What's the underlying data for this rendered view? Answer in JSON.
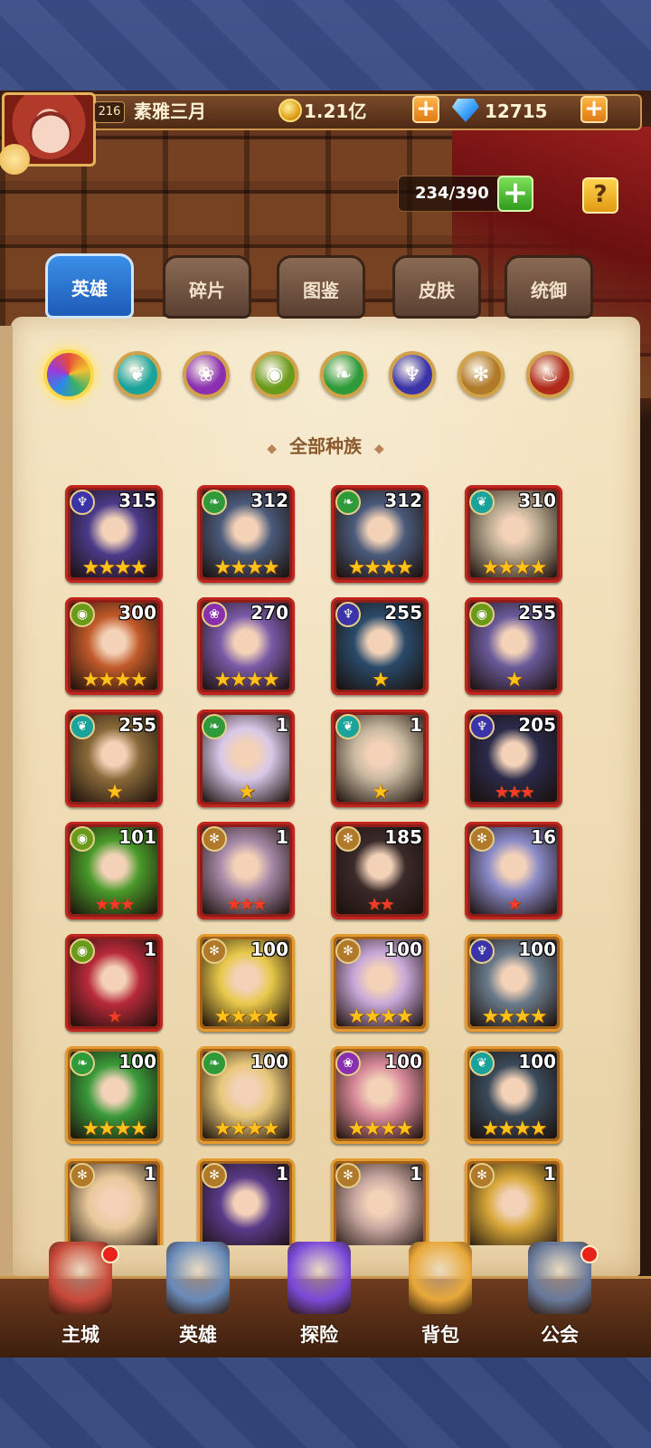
{
  "player": {
    "level": "216",
    "name": "素雅三月",
    "gold": "1.21亿",
    "gems": "12715"
  },
  "capacity": "234/390",
  "help_label": "?",
  "tabs": [
    {
      "label": "英雄",
      "active": true
    },
    {
      "label": "碎片",
      "active": false
    },
    {
      "label": "图鉴",
      "active": false
    },
    {
      "label": "皮肤",
      "active": false
    },
    {
      "label": "统御",
      "active": false
    }
  ],
  "race_filters": [
    {
      "icon": "all-races-icon",
      "color": "#e84a3a",
      "active": true
    },
    {
      "icon": "race-cyan-icon",
      "color": "#1aa39a"
    },
    {
      "icon": "race-purple-icon",
      "color": "#8a2fb0"
    },
    {
      "icon": "race-green-eye-icon",
      "color": "#6a9a1a"
    },
    {
      "icon": "race-leaf-icon",
      "color": "#2f9a3a"
    },
    {
      "icon": "race-demon-icon",
      "color": "#3a34a8"
    },
    {
      "icon": "race-light-icon",
      "color": "#b07a2a"
    },
    {
      "icon": "race-red-icon",
      "color": "#b02a1a"
    }
  ],
  "section_title": "全部种族",
  "heroes": [
    {
      "level": "315",
      "race": "demon",
      "stars": "★★★★",
      "star_type": "gold",
      "frame": "red",
      "color": "#4a3a8a"
    },
    {
      "level": "312",
      "race": "leaf",
      "stars": "★★★★",
      "star_type": "gold",
      "frame": "red",
      "color": "#4a5a7a"
    },
    {
      "level": "312",
      "race": "leaf",
      "stars": "★★★★",
      "star_type": "gold",
      "frame": "red",
      "color": "#4a5a7a"
    },
    {
      "level": "310",
      "race": "cyan",
      "stars": "★★★★",
      "star_type": "gold",
      "frame": "red",
      "color": "#b8a890"
    },
    {
      "level": "300",
      "race": "green-eye",
      "stars": "★★★★",
      "star_type": "gold",
      "frame": "red",
      "color": "#c25a2a"
    },
    {
      "level": "270",
      "race": "purple",
      "stars": "★★★★",
      "star_type": "gold",
      "frame": "red",
      "color": "#7a5aa8"
    },
    {
      "level": "255",
      "race": "demon",
      "stars": "★",
      "star_type": "gold",
      "frame": "red",
      "color": "#2a4a6a"
    },
    {
      "level": "255",
      "race": "green-eye",
      "stars": "★",
      "star_type": "gold",
      "frame": "red",
      "color": "#6a5a9a"
    },
    {
      "level": "255",
      "race": "cyan",
      "stars": "★",
      "star_type": "gold",
      "frame": "red",
      "color": "#8a6a3a"
    },
    {
      "level": "1",
      "race": "leaf",
      "stars": "★",
      "star_type": "gold",
      "frame": "red",
      "color": "#d8c8e8"
    },
    {
      "level": "1",
      "race": "cyan",
      "stars": "★",
      "star_type": "gold",
      "frame": "red",
      "color": "#c8b8a0"
    },
    {
      "level": "205",
      "race": "demon",
      "stars": "★★★",
      "star_type": "red",
      "frame": "red",
      "color": "#2a2a4a"
    },
    {
      "level": "101",
      "race": "green-eye",
      "stars": "★★★",
      "star_type": "red",
      "frame": "red",
      "color": "#4a9a2a"
    },
    {
      "level": "1",
      "race": "light",
      "stars": "★★★",
      "star_type": "red",
      "frame": "red",
      "color": "#a88aa8"
    },
    {
      "level": "185",
      "race": "light",
      "stars": "★★",
      "star_type": "red",
      "frame": "red",
      "color": "#3a2a2a"
    },
    {
      "level": "16",
      "race": "light",
      "stars": "★",
      "star_type": "red",
      "frame": "red",
      "color": "#8a8ac8"
    },
    {
      "level": "1",
      "race": "green-eye",
      "stars": "★",
      "star_type": "red",
      "frame": "red",
      "color": "#b82a3a"
    },
    {
      "level": "100",
      "race": "light",
      "stars": "★★★★",
      "star_type": "gold",
      "frame": "gold",
      "color": "#e8c84a"
    },
    {
      "level": "100",
      "race": "light",
      "stars": "★★★★",
      "star_type": "gold",
      "frame": "gold",
      "color": "#c8a8d8"
    },
    {
      "level": "100",
      "race": "demon",
      "stars": "★★★★",
      "star_type": "gold",
      "frame": "gold",
      "color": "#6a7a8a"
    },
    {
      "level": "100",
      "race": "leaf",
      "stars": "★★★★",
      "star_type": "gold",
      "frame": "gold",
      "color": "#3a9a3a"
    },
    {
      "level": "100",
      "race": "leaf",
      "stars": "★★★★",
      "star_type": "gold",
      "frame": "gold",
      "color": "#e8c87a"
    },
    {
      "level": "100",
      "race": "purple",
      "stars": "★★★★",
      "star_type": "gold",
      "frame": "gold",
      "color": "#d88a9a"
    },
    {
      "level": "100",
      "race": "cyan",
      "stars": "★★★★",
      "star_type": "gold",
      "frame": "gold",
      "color": "#3a4a5a"
    },
    {
      "level": "1",
      "race": "light",
      "stars": "",
      "star_type": "gold",
      "frame": "gold",
      "color": "#e8c89a"
    },
    {
      "level": "1",
      "race": "light",
      "stars": "",
      "star_type": "gold",
      "frame": "gold",
      "color": "#5a3a8a"
    },
    {
      "level": "1",
      "race": "light",
      "stars": "",
      "star_type": "gold",
      "frame": "gold",
      "color": "#c8a8a0"
    },
    {
      "level": "1",
      "race": "light",
      "stars": "",
      "star_type": "gold",
      "frame": "gold",
      "color": "#d8a83a"
    }
  ],
  "bottom_nav": [
    {
      "label": "主城",
      "icon": "castle-icon",
      "badge": true,
      "color": "#c84a3a"
    },
    {
      "label": "英雄",
      "icon": "hero-icon",
      "badge": false,
      "color": "#6a8ab8"
    },
    {
      "label": "探险",
      "icon": "portal-icon",
      "badge": false,
      "color": "#7a4ad8"
    },
    {
      "label": "背包",
      "icon": "backpack-icon",
      "badge": false,
      "color": "#e8a83a"
    },
    {
      "label": "公会",
      "icon": "guild-tower-icon",
      "badge": true,
      "color": "#6a7a9a"
    }
  ]
}
